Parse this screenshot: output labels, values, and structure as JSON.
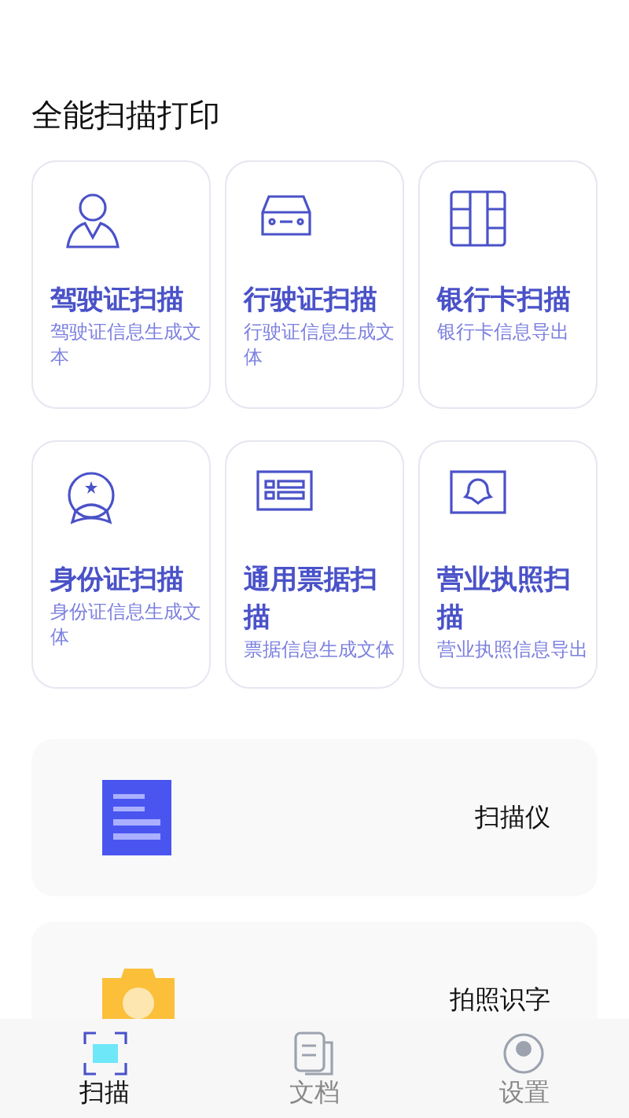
{
  "title": "全能扫描打印",
  "cards": [
    {
      "kind": "driver",
      "title": "驾驶证扫描",
      "subtitle": "驾驶证信息生成文本"
    },
    {
      "kind": "vehicle",
      "title": "行驶证扫描",
      "subtitle": "行驶证信息生成文体"
    },
    {
      "kind": "bank",
      "title": "银行卡扫描",
      "subtitle": "银行卡信息导出"
    },
    {
      "kind": "id",
      "title": "身份证扫描",
      "subtitle": "身份证信息生成文体"
    },
    {
      "kind": "receipt",
      "title": "通用票据扫描",
      "subtitle": "票据信息生成文体"
    },
    {
      "kind": "license",
      "title": "营业执照扫描",
      "subtitle": "营业执照信息导出"
    }
  ],
  "tools": [
    {
      "kind": "scanner",
      "label": "扫描仪"
    },
    {
      "kind": "camera",
      "label": "拍照识字"
    }
  ],
  "nav": [
    {
      "kind": "scan",
      "label": "扫描",
      "selected": true
    },
    {
      "kind": "docs",
      "label": "文档",
      "selected": false
    },
    {
      "kind": "settings",
      "label": "设置",
      "selected": false
    }
  ]
}
